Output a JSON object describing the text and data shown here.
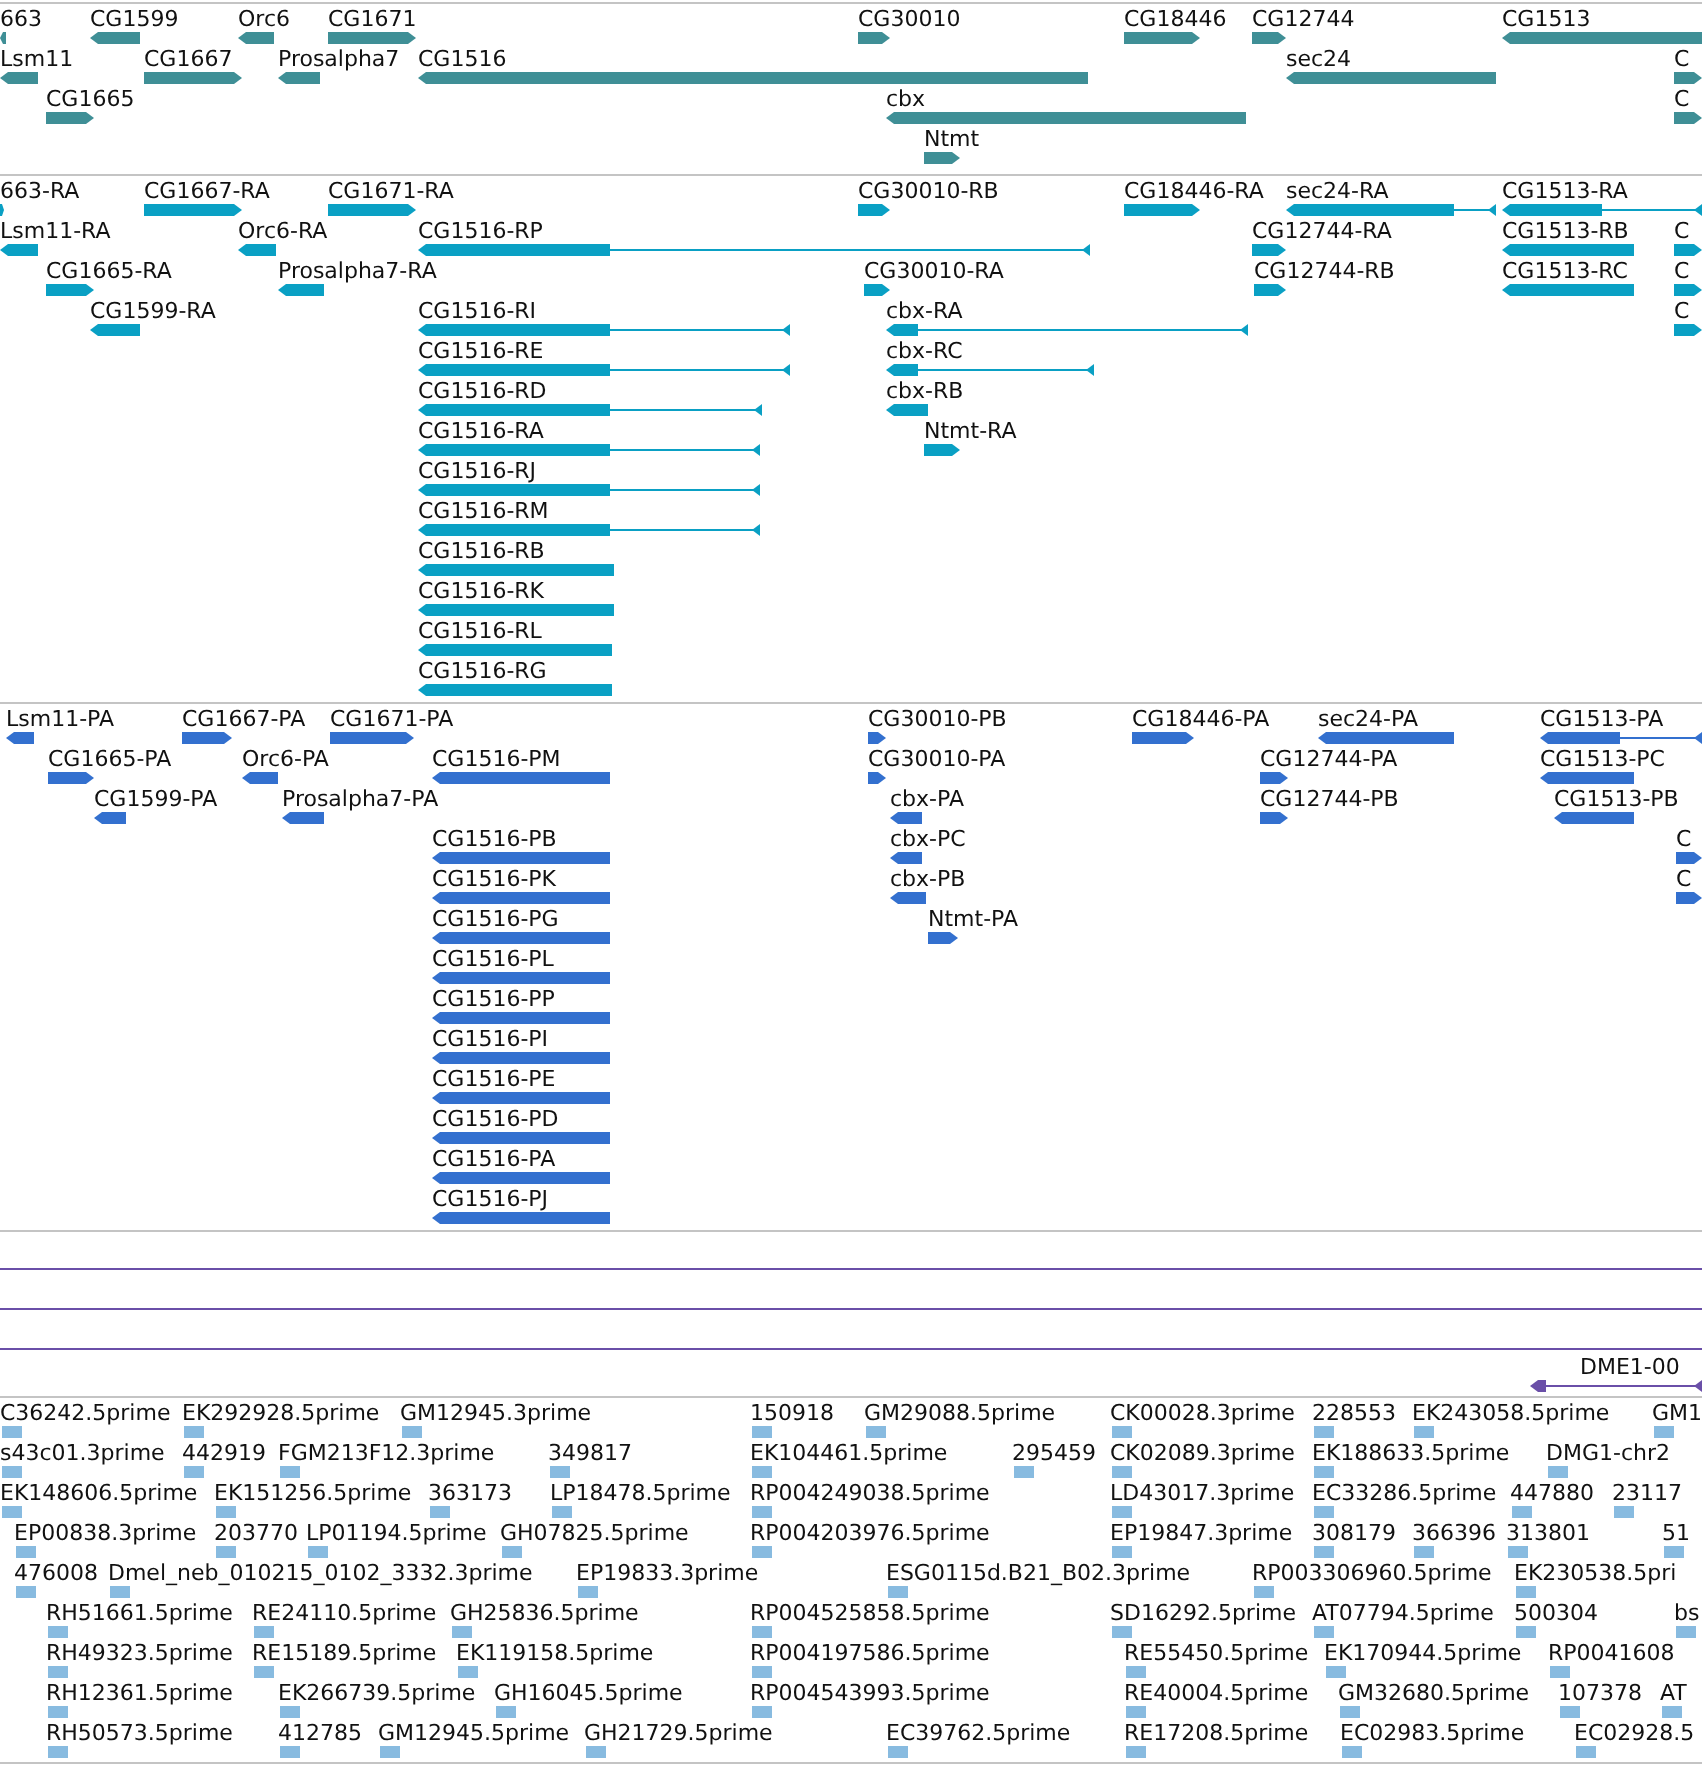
{
  "tracks": [
    {
      "kind": "genes",
      "features": [
        {
          "label": "663",
          "reverse": true
        },
        {
          "label": "CG1599",
          "reverse": true
        },
        {
          "label": "Orc6",
          "reverse": true
        },
        {
          "label": "CG1671",
          "reverse": false
        },
        {
          "label": "CG30010",
          "reverse": false
        },
        {
          "label": "CG18446",
          "reverse": false
        },
        {
          "label": "CG12744",
          "reverse": false
        },
        {
          "label": "CG1513",
          "reverse": true
        },
        {
          "label": "Lsm11",
          "reverse": true
        },
        {
          "label": "CG1667",
          "reverse": false
        },
        {
          "label": "Prosalpha7",
          "reverse": true
        },
        {
          "label": "CG1516",
          "reverse": true
        },
        {
          "label": "sec24",
          "reverse": true
        },
        {
          "label": "C",
          "reverse": false
        },
        {
          "label": "CG1665",
          "reverse": false
        },
        {
          "label": "cbx",
          "reverse": true
        },
        {
          "label": "C",
          "reverse": false
        },
        {
          "label": "Ntmt",
          "reverse": false
        }
      ]
    },
    {
      "kind": "transcripts",
      "features": [
        {
          "label": "663-RA",
          "reverse": false
        },
        {
          "label": "CG1667-RA",
          "reverse": false
        },
        {
          "label": "CG1671-RA",
          "reverse": false
        },
        {
          "label": "CG30010-RB",
          "reverse": false
        },
        {
          "label": "CG18446-RA",
          "reverse": false
        },
        {
          "label": "sec24-RA",
          "reverse": true
        },
        {
          "label": "CG1513-RA",
          "reverse": true
        },
        {
          "label": "Lsm11-RA",
          "reverse": true
        },
        {
          "label": "Orc6-RA",
          "reverse": true
        },
        {
          "label": "CG1516-RP",
          "reverse": true
        },
        {
          "label": "CG12744-RA",
          "reverse": false
        },
        {
          "label": "CG1513-RB",
          "reverse": true
        },
        {
          "label": "C",
          "reverse": false
        },
        {
          "label": "CG1665-RA",
          "reverse": false
        },
        {
          "label": "Prosalpha7-RA",
          "reverse": true
        },
        {
          "label": "CG30010-RA",
          "reverse": false
        },
        {
          "label": "CG12744-RB",
          "reverse": false
        },
        {
          "label": "CG1513-RC",
          "reverse": true
        },
        {
          "label": "C",
          "reverse": false
        },
        {
          "label": "CG1599-RA",
          "reverse": true
        },
        {
          "label": "CG1516-RI",
          "reverse": true
        },
        {
          "label": "cbx-RA",
          "reverse": true
        },
        {
          "label": "C",
          "reverse": false
        },
        {
          "label": "CG1516-RE",
          "reverse": true
        },
        {
          "label": "cbx-RC",
          "reverse": true
        },
        {
          "label": "CG1516-RD",
          "reverse": true
        },
        {
          "label": "cbx-RB",
          "reverse": true
        },
        {
          "label": "CG1516-RA",
          "reverse": true
        },
        {
          "label": "Ntmt-RA",
          "reverse": false
        },
        {
          "label": "CG1516-RJ",
          "reverse": true
        },
        {
          "label": "CG1516-RM",
          "reverse": true
        },
        {
          "label": "CG1516-RB",
          "reverse": true
        },
        {
          "label": "CG1516-RK",
          "reverse": true
        },
        {
          "label": "CG1516-RL",
          "reverse": true
        },
        {
          "label": "CG1516-RG",
          "reverse": true
        }
      ]
    },
    {
      "kind": "proteins",
      "features": [
        {
          "label": "Lsm11-PA",
          "reverse": true
        },
        {
          "label": "CG1667-PA",
          "reverse": false
        },
        {
          "label": "CG1671-PA",
          "reverse": false
        },
        {
          "label": "CG30010-PB",
          "reverse": false
        },
        {
          "label": "CG18446-PA",
          "reverse": false
        },
        {
          "label": "sec24-PA",
          "reverse": true
        },
        {
          "label": "CG1513-PA",
          "reverse": true
        },
        {
          "label": "CG1665-PA",
          "reverse": false
        },
        {
          "label": "Orc6-PA",
          "reverse": true
        },
        {
          "label": "CG1516-PM",
          "reverse": true
        },
        {
          "label": "CG30010-PA",
          "reverse": false
        },
        {
          "label": "CG12744-PA",
          "reverse": false
        },
        {
          "label": "CG1513-PC",
          "reverse": true
        },
        {
          "label": "CG1599-PA",
          "reverse": true
        },
        {
          "label": "Prosalpha7-PA",
          "reverse": true
        },
        {
          "label": "cbx-PA",
          "reverse": true
        },
        {
          "label": "CG12744-PB",
          "reverse": false
        },
        {
          "label": "CG1513-PB",
          "reverse": true
        },
        {
          "label": "CG1516-PB",
          "reverse": true
        },
        {
          "label": "cbx-PC",
          "reverse": true
        },
        {
          "label": "C",
          "reverse": false
        },
        {
          "label": "CG1516-PK",
          "reverse": true
        },
        {
          "label": "cbx-PB",
          "reverse": true
        },
        {
          "label": "C",
          "reverse": false
        },
        {
          "label": "CG1516-PG",
          "reverse": true
        },
        {
          "label": "Ntmt-PA",
          "reverse": false
        },
        {
          "label": "CG1516-PL",
          "reverse": true
        },
        {
          "label": "CG1516-PP",
          "reverse": true
        },
        {
          "label": "CG1516-PI",
          "reverse": true
        },
        {
          "label": "CG1516-PE",
          "reverse": true
        },
        {
          "label": "CG1516-PD",
          "reverse": true
        },
        {
          "label": "CG1516-PA",
          "reverse": true
        },
        {
          "label": "CG1516-PJ",
          "reverse": true
        }
      ]
    },
    {
      "kind": "repeats",
      "features": [
        {
          "label": "DME1-00",
          "reverse": true
        }
      ]
    },
    {
      "kind": "ests",
      "features": [
        {
          "label": "C36242.5prime"
        },
        {
          "label": "EK292928.5prime"
        },
        {
          "label": "GM12945.3prime"
        },
        {
          "label": "150918"
        },
        {
          "label": "GM29088.5prime"
        },
        {
          "label": "CK00028.3prime"
        },
        {
          "label": "228553"
        },
        {
          "label": "EK243058.5prime"
        },
        {
          "label": "GM1"
        },
        {
          "label": "s43c01.3prime"
        },
        {
          "label": "442919"
        },
        {
          "label": "FGM213F12.3prime"
        },
        {
          "label": "349817"
        },
        {
          "label": "EK104461.5prime"
        },
        {
          "label": "295459"
        },
        {
          "label": "CK02089.3prime"
        },
        {
          "label": "EK188633.5prime"
        },
        {
          "label": "DMG1-chr2"
        },
        {
          "label": "EK148606.5prime"
        },
        {
          "label": "EK151256.5prime"
        },
        {
          "label": "363173"
        },
        {
          "label": "LP18478.5prime"
        },
        {
          "label": "RP004249038.5prime"
        },
        {
          "label": "LD43017.3prime"
        },
        {
          "label": "EC33286.5prime"
        },
        {
          "label": "447880"
        },
        {
          "label": "23117"
        },
        {
          "label": "EP00838.3prime"
        },
        {
          "label": "203770"
        },
        {
          "label": "LP01194.5prime"
        },
        {
          "label": "GH07825.5prime"
        },
        {
          "label": "RP004203976.5prime"
        },
        {
          "label": "EP19847.3prime"
        },
        {
          "label": "308179"
        },
        {
          "label": "366396"
        },
        {
          "label": "313801"
        },
        {
          "label": "51"
        },
        {
          "label": "476008"
        },
        {
          "label": "Dmel_neb_010215_0102_3332.3prime"
        },
        {
          "label": "EP19833.3prime"
        },
        {
          "label": "ESG0115d.B21_B02.3prime"
        },
        {
          "label": "RP003306960.5prime"
        },
        {
          "label": "EK230538.5pri"
        },
        {
          "label": "RH51661.5prime"
        },
        {
          "label": "RE24110.5prime"
        },
        {
          "label": "GH25836.5prime"
        },
        {
          "label": "RP004525858.5prime"
        },
        {
          "label": "SD16292.5prime"
        },
        {
          "label": "AT07794.5prime"
        },
        {
          "label": "500304"
        },
        {
          "label": "bs"
        },
        {
          "label": "RH49323.5prime"
        },
        {
          "label": "RE15189.5prime"
        },
        {
          "label": "EK119158.5prime"
        },
        {
          "label": "RP004197586.5prime"
        },
        {
          "label": "RE55450.5prime"
        },
        {
          "label": "EK170944.5prime"
        },
        {
          "label": "RP0041608"
        },
        {
          "label": "RH12361.5prime"
        },
        {
          "label": "EK266739.5prime"
        },
        {
          "label": "GH16045.5prime"
        },
        {
          "label": "RP004543993.5prime"
        },
        {
          "label": "RE40004.5prime"
        },
        {
          "label": "GM32680.5prime"
        },
        {
          "label": "107378"
        },
        {
          "label": "AT"
        },
        {
          "label": "RH50573.5prime"
        },
        {
          "label": "412785"
        },
        {
          "label": "GM12945.5prime"
        },
        {
          "label": "GH21729.5prime"
        },
        {
          "label": "EC39762.5prime"
        },
        {
          "label": "RE17208.5prime"
        },
        {
          "label": "EC02983.5prime"
        },
        {
          "label": "EC02928.5"
        }
      ]
    }
  ]
}
